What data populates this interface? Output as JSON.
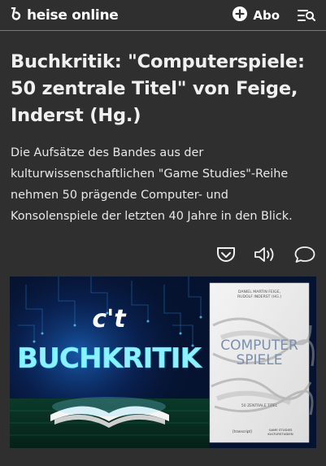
{
  "header": {
    "brand": "heise online",
    "abo_label": "Abo",
    "icons": {
      "logo": "heise-logo-icon",
      "plus": "plus-circle-icon",
      "menu": "menu-search-icon"
    }
  },
  "article": {
    "title": "Buchkritik: \"Computerspiele: 50 zentrale Titel\" von Feige, Inderst (Hg.)",
    "teaser": "Die Aufsätze des Bandes aus der kulturwissenschaftlichen \"Game Studies\"-Reihe nehmen 50 prägende Computer- und Konsolenspiele der letzten 40 Jahre in den Blick.",
    "actions": [
      "pocket-icon",
      "read-aloud-icon",
      "comment-icon"
    ]
  },
  "hero": {
    "badge": "c't",
    "banner": "BUCHKRITIK",
    "book": {
      "authors_line1": "DANIEL MARTIN FEIGE,",
      "authors_line2": "RUDOLF INDERST (HG.)",
      "title_line1": "COMPUTER",
      "title_line2": "SPIELE",
      "subtitle": "50 ZENTRALE TITEL",
      "publisher": "[transcript]",
      "series_line1": "GAME STUDIES",
      "series_line2": "KULTURSTUDIEN"
    },
    "colors": {
      "neon": "#2fd6ff",
      "bg": "#061330"
    }
  }
}
